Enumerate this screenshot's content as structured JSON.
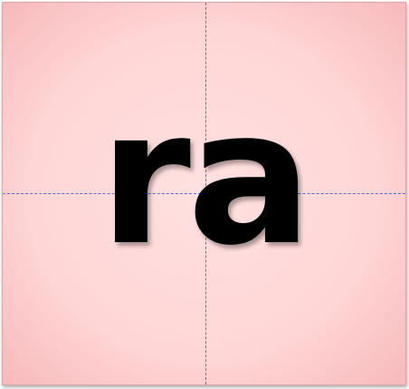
{
  "card": {
    "syllable": "ra",
    "background_color": "#ffd6d6",
    "edge_color": "#f7b9bb",
    "guide_color": "#5a6fd0",
    "text_color": "#000000"
  }
}
